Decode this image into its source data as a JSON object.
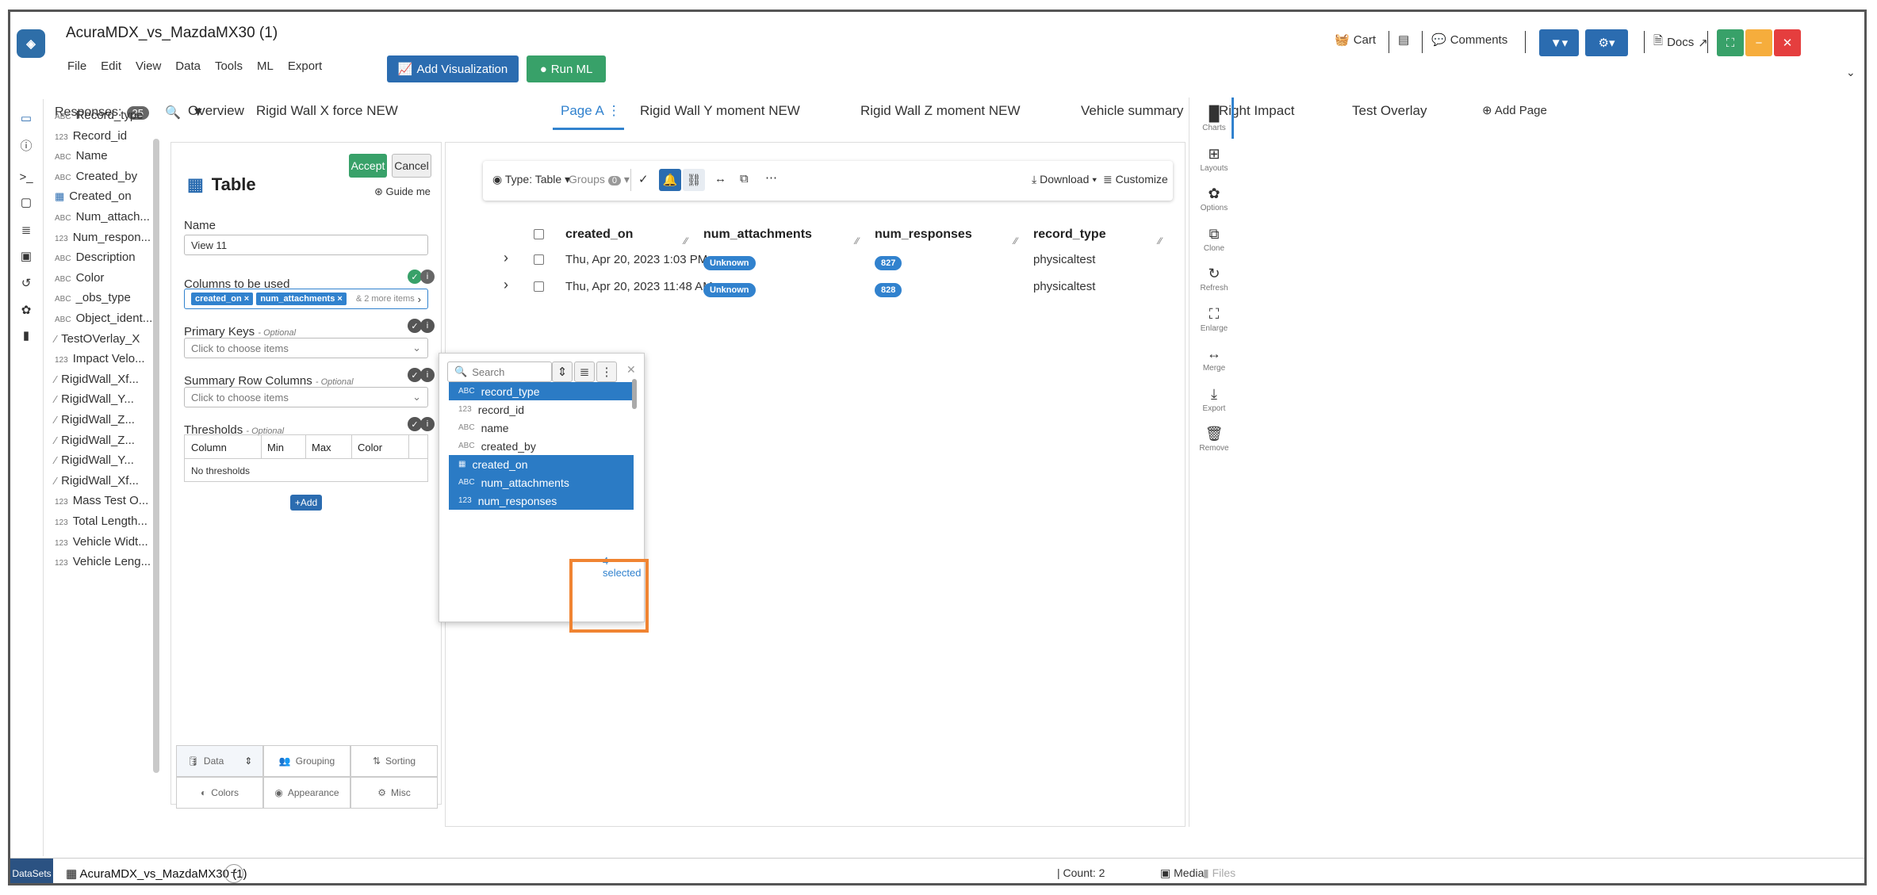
{
  "app": {
    "title": "AcuraMDX_vs_MazdaMX30 (1)",
    "menu": [
      "File",
      "Edit",
      "View",
      "Data",
      "Tools",
      "ML",
      "Export"
    ],
    "add_visualization": "Add Visualization",
    "run_ml": "Run ML",
    "cart": "Cart",
    "comments": "Comments",
    "docs": "Docs"
  },
  "colors": {
    "accent": "#2b6cb0",
    "green": "#38a169",
    "orange": "#f08432",
    "window_min": "#f6ad3c",
    "window_close": "#e53e3e",
    "window_expand": "#38a169"
  },
  "responses": {
    "label": "Responses:",
    "count": "25",
    "items": [
      {
        "type": "ABC",
        "label": "Record_type"
      },
      {
        "type": "123",
        "label": "Record_id"
      },
      {
        "type": "ABC",
        "label": "Name"
      },
      {
        "type": "ABC",
        "label": "Created_by"
      },
      {
        "type": "date",
        "label": "Created_on"
      },
      {
        "type": "ABC",
        "label": "Num_attach..."
      },
      {
        "type": "123",
        "label": "Num_respon..."
      },
      {
        "type": "ABC",
        "label": "Description"
      },
      {
        "type": "ABC",
        "label": "Color"
      },
      {
        "type": "ABC",
        "label": "_obs_type"
      },
      {
        "type": "ABC",
        "label": "Object_ident..."
      },
      {
        "type": "curve",
        "label": "TestOVerlay_X"
      },
      {
        "type": "123",
        "label": "Impact Velo..."
      },
      {
        "type": "curve",
        "label": "RigidWall_Xf..."
      },
      {
        "type": "curve",
        "label": "RigidWall_Y..."
      },
      {
        "type": "curve",
        "label": "RigidWall_Z..."
      },
      {
        "type": "curve",
        "label": "RigidWall_Z..."
      },
      {
        "type": "curve",
        "label": "RigidWall_Y..."
      },
      {
        "type": "curve",
        "label": "RigidWall_Xf..."
      },
      {
        "type": "123",
        "label": "Mass Test O..."
      },
      {
        "type": "123",
        "label": "Total Length..."
      },
      {
        "type": "123",
        "label": "Vehicle Widt..."
      },
      {
        "type": "123",
        "label": "Vehicle Leng..."
      }
    ]
  },
  "pages": {
    "tabs": [
      "Overview",
      "Rigid Wall X force NEW",
      "Page A",
      "Rigid Wall Y moment NEW",
      "Rigid Wall Z moment NEW",
      "Vehicle summary",
      "Right Impact",
      "Test Overlay"
    ],
    "active": "Page A",
    "add_page": "Add Page"
  },
  "editor": {
    "title": "Table",
    "accept": "Accept",
    "cancel": "Cancel",
    "guide": "Guide me",
    "name_label": "Name",
    "name_value": "View 11",
    "columns_label": "Columns to be used",
    "columns_chips": [
      "created_on",
      "num_attachments"
    ],
    "columns_more": "& 2 more items",
    "primary_keys_label": "Primary Keys",
    "summary_label": "Summary Row Columns",
    "thresholds_label": "Thresholds",
    "optional": "- Optional",
    "choose_placeholder": "Click to choose items",
    "threshold_cols": [
      "Column",
      "Min",
      "Max",
      "Color"
    ],
    "no_thresholds": "No thresholds",
    "add": "Add",
    "settings_tabs": [
      "Data",
      "Grouping",
      "Sorting",
      "Colors",
      "Appearance",
      "Misc"
    ]
  },
  "toolbar": {
    "type": "Type: Table",
    "groups": "Groups",
    "groups_count": "0",
    "download": "Download",
    "customize": "Customize"
  },
  "table": {
    "headers": [
      "created_on",
      "num_attachments",
      "num_responses",
      "record_type"
    ],
    "rows": [
      {
        "created_on": "Thu, Apr 20, 2023 1:03 PM",
        "num_attachments": "Unknown",
        "num_responses": "827",
        "record_type": "physicaltest"
      },
      {
        "created_on": "Thu, Apr 20, 2023 11:48 AM",
        "num_attachments": "Unknown",
        "num_responses": "828",
        "record_type": "physicaltest"
      }
    ]
  },
  "dropdown": {
    "search_placeholder": "Search",
    "items": [
      {
        "type": "ABC",
        "label": "record_type",
        "selected": true
      },
      {
        "type": "123",
        "label": "record_id",
        "selected": false
      },
      {
        "type": "ABC",
        "label": "name",
        "selected": false
      },
      {
        "type": "ABC",
        "label": "created_by",
        "selected": false
      },
      {
        "type": "date",
        "label": "created_on",
        "selected": true
      },
      {
        "type": "ABC",
        "label": "num_attachments",
        "selected": true
      },
      {
        "type": "123",
        "label": "num_responses",
        "selected": true
      }
    ],
    "selected_text": "4 selected"
  },
  "right_rail": [
    "Charts",
    "Layouts",
    "Options",
    "Clone",
    "Refresh",
    "Enlarge",
    "Merge",
    "Export",
    "Remove"
  ],
  "bottom": {
    "datasets": "DataSets",
    "tab": "AcuraMDX_vs_MazdaMX30 (1)",
    "count": "Count: 2",
    "media": "Media",
    "files": "Files"
  }
}
